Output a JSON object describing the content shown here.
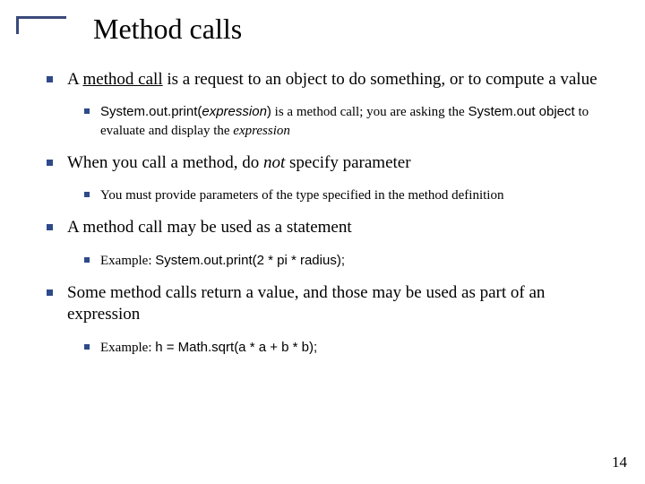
{
  "title": "Method calls",
  "b1": {
    "pref": "A ",
    "u": "method call",
    "post": " is a request to an object to do something, or to compute a value"
  },
  "b1s": {
    "c1": "System.out.print(",
    "e": "expression",
    "c2": ")",
    "t1": " is a method call; you are asking the ",
    "c3": "System.out object",
    "t2": " to evaluate and display the ",
    "e2": "expression"
  },
  "b2": {
    "t1": "When you call a method, do ",
    "n": "not",
    "t2": " specify parameter"
  },
  "b2s": "You must provide parameters of the type specified in the method definition",
  "b3": "A method call may be used as a statement",
  "b3s": {
    "ex": "Example: ",
    "code": "System.out.print(2 * pi * radius);"
  },
  "b4": "Some method calls return a value, and those may be used as part of an expression",
  "b4s": {
    "ex": "Example: ",
    "code": "h = Math.sqrt(a * a + b * b);"
  },
  "page": "14"
}
